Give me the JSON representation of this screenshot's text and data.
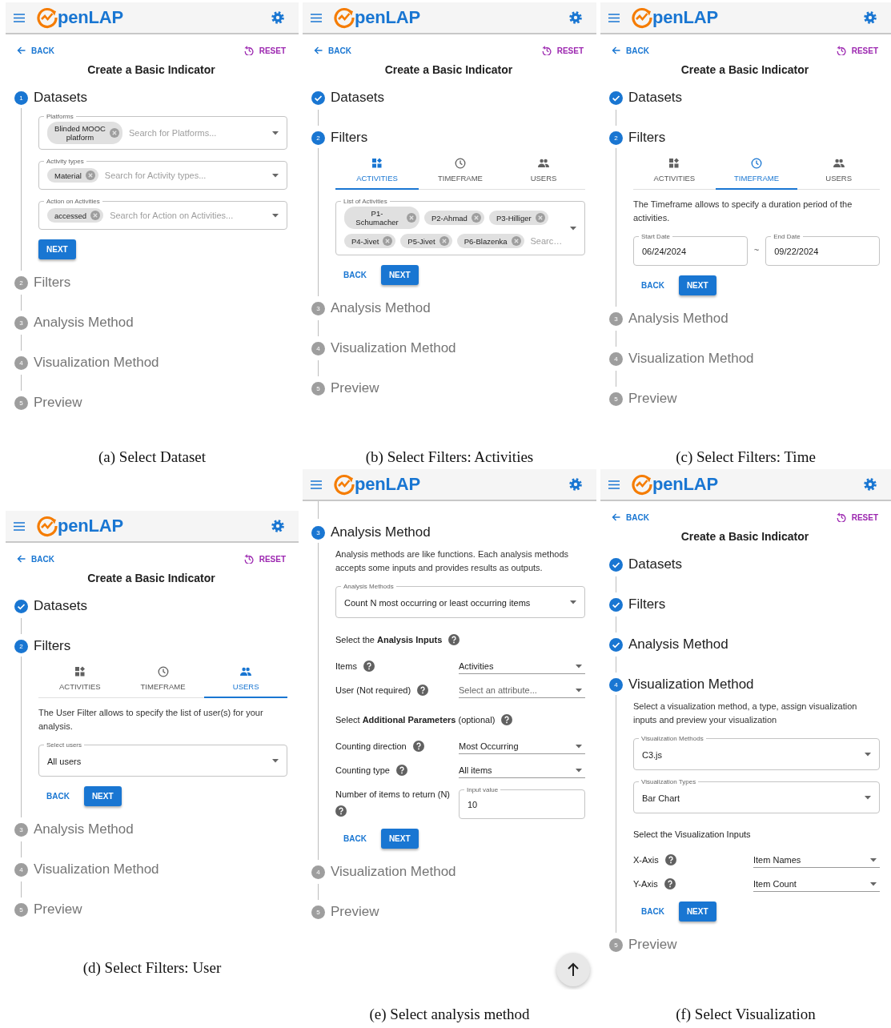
{
  "panels": [
    {
      "app_title": "penLAP",
      "nav": {
        "back": "BACK",
        "reset": "RESET",
        "title": "Create a Basic Indicator"
      },
      "caption": "(a) Select Dataset",
      "steps": [
        {
          "number": "1",
          "title": "Datasets",
          "completed": false,
          "active": true,
          "body": [
            {
              "kind": "autocomplete",
              "label": "Platforms",
              "chips": [
                "Blinded MOOC platform"
              ],
              "placeholder": "Search for Platforms..."
            },
            {
              "kind": "autocomplete",
              "label": "Activity types",
              "chips": [
                "Material"
              ],
              "placeholder": "Search for Activity types..."
            },
            {
              "kind": "autocomplete",
              "label": "Action on Activities",
              "chips": [
                "accessed"
              ],
              "placeholder": "Search for Action on Activities..."
            },
            {
              "kind": "buttons",
              "buttons": [
                {
                  "label": "NEXT",
                  "kind": "contained"
                }
              ]
            }
          ]
        },
        {
          "number": "2",
          "title": "Filters",
          "completed": false,
          "active": false
        },
        {
          "number": "3",
          "title": "Analysis Method",
          "completed": false,
          "active": false
        },
        {
          "number": "4",
          "title": "Visualization Method",
          "completed": false,
          "active": false
        },
        {
          "number": "5",
          "title": "Preview",
          "completed": false,
          "active": false
        }
      ]
    },
    {
      "app_title": "penLAP",
      "nav": {
        "back": "BACK",
        "reset": "RESET",
        "title": "Create a Basic Indicator"
      },
      "caption": "(b) Select Filters: Activities",
      "steps": [
        {
          "title": "Datasets",
          "completed": true,
          "active": false
        },
        {
          "number": "2",
          "title": "Filters",
          "completed": false,
          "active": true,
          "body": [
            {
              "kind": "tabs",
              "tabs": [
                {
                  "label": "ACTIVITIES",
                  "kind": "activities",
                  "selected": true
                },
                {
                  "label": "TIMEFRAME",
                  "kind": "timeframe",
                  "selected": false
                },
                {
                  "label": "USERS",
                  "kind": "users",
                  "selected": false
                }
              ]
            },
            {
              "kind": "autocomplete",
              "label": "List of Activities",
              "chips": [
                "P1-Schumacher",
                "P2-Ahmad",
                "P3-Hilliger",
                "P4-Jivet",
                "P5-Jivet",
                "P6-Blazenka"
              ],
              "placeholder": "Searc…"
            },
            {
              "kind": "buttons",
              "buttons": [
                {
                  "label": "BACK",
                  "kind": "text"
                },
                {
                  "label": "NEXT",
                  "kind": "contained"
                }
              ]
            }
          ]
        },
        {
          "number": "3",
          "title": "Analysis Method",
          "completed": false,
          "active": false
        },
        {
          "number": "4",
          "title": "Visualization Method",
          "completed": false,
          "active": false
        },
        {
          "number": "5",
          "title": "Preview",
          "completed": false,
          "active": false
        }
      ]
    },
    {
      "app_title": "penLAP",
      "nav": {
        "back": "BACK",
        "reset": "RESET",
        "title": "Create a Basic Indicator"
      },
      "caption": "(c) Select Filters: Time",
      "steps": [
        {
          "title": "Datasets",
          "completed": true,
          "active": false
        },
        {
          "number": "2",
          "title": "Filters",
          "completed": false,
          "active": true,
          "body": [
            {
              "kind": "tabs",
              "tabs": [
                {
                  "label": "ACTIVITIES",
                  "kind": "activities",
                  "selected": false
                },
                {
                  "label": "TIMEFRAME",
                  "kind": "timeframe",
                  "selected": true
                },
                {
                  "label": "USERS",
                  "kind": "users",
                  "selected": false
                }
              ]
            },
            {
              "kind": "text",
              "text": "The Timeframe allows to specify a duration period of the activities."
            },
            {
              "kind": "date_range",
              "separator": "~",
              "fields": [
                {
                  "label": "Start Date",
                  "value": "06/24/2024"
                },
                {
                  "label": "End Date",
                  "value": "09/22/2024"
                }
              ]
            },
            {
              "kind": "buttons",
              "buttons": [
                {
                  "label": "BACK",
                  "kind": "text"
                },
                {
                  "label": "NEXT",
                  "kind": "contained"
                }
              ]
            }
          ]
        },
        {
          "number": "3",
          "title": "Analysis Method",
          "completed": false,
          "active": false
        },
        {
          "number": "4",
          "title": "Visualization Method",
          "completed": false,
          "active": false
        },
        {
          "number": "5",
          "title": "Preview",
          "completed": false,
          "active": false
        }
      ]
    },
    {
      "app_title": "penLAP",
      "nav": {
        "back": "BACK",
        "reset": "RESET",
        "title": "Create a Basic Indicator"
      },
      "caption": "(d) Select Filters: User",
      "steps": [
        {
          "title": "Datasets",
          "completed": true,
          "active": false
        },
        {
          "number": "2",
          "title": "Filters",
          "completed": false,
          "active": true,
          "body": [
            {
              "kind": "tabs",
              "tabs": [
                {
                  "label": "ACTIVITIES",
                  "kind": "activities",
                  "selected": false
                },
                {
                  "label": "TIMEFRAME",
                  "kind": "timeframe",
                  "selected": false
                },
                {
                  "label": "USERS",
                  "kind": "users",
                  "selected": true
                }
              ]
            },
            {
              "kind": "text",
              "text": "The User Filter allows to specify the list of user(s) for your analysis."
            },
            {
              "kind": "select_outlined",
              "label": "Select users",
              "value": "All users"
            },
            {
              "kind": "buttons",
              "buttons": [
                {
                  "label": "BACK",
                  "kind": "text"
                },
                {
                  "label": "NEXT",
                  "kind": "contained"
                }
              ]
            }
          ]
        },
        {
          "number": "3",
          "title": "Analysis Method",
          "completed": false,
          "active": false
        },
        {
          "number": "4",
          "title": "Visualization Method",
          "completed": false,
          "active": false
        },
        {
          "number": "5",
          "title": "Preview",
          "completed": false,
          "active": false
        }
      ]
    },
    {
      "app_title": "penLAP",
      "continued": true,
      "scroll_top_button": true,
      "caption": "(e) Select analysis method",
      "steps": [
        {
          "number": "3",
          "title": "Analysis Method",
          "completed": false,
          "active": true,
          "body": [
            {
              "kind": "text",
              "text": "Analysis methods are like functions. Each analysis methods accepts some inputs and provides results as outputs."
            },
            {
              "kind": "select_outlined",
              "label": "Analysis Methods",
              "value": "Count N most occurring or least occurring items"
            },
            {
              "kind": "heading",
              "text": "Select the **Analysis Inputs**",
              "help": true
            },
            {
              "kind": "param",
              "label": "Items",
              "help": true,
              "control": {
                "kind": "select_underline",
                "value": "Activities"
              }
            },
            {
              "kind": "param",
              "label": "User (Not required)",
              "help": true,
              "control": {
                "kind": "select_underline",
                "placeholder": "Select an attribute..."
              }
            },
            {
              "kind": "heading",
              "text": "Select **Additional Parameters** (optional)",
              "help": true
            },
            {
              "kind": "param",
              "label": "Counting direction",
              "help": true,
              "control": {
                "kind": "select_underline",
                "value": "Most Occurring"
              }
            },
            {
              "kind": "param",
              "label": "Counting type",
              "help": true,
              "control": {
                "kind": "select_underline",
                "value": "All items"
              }
            },
            {
              "kind": "param",
              "label": "Number of items to return (N)",
              "help": true,
              "control": {
                "kind": "input_outlined",
                "label": "Input value",
                "value": "10"
              }
            },
            {
              "kind": "buttons",
              "buttons": [
                {
                  "label": "BACK",
                  "kind": "text"
                },
                {
                  "label": "NEXT",
                  "kind": "contained"
                }
              ]
            }
          ]
        },
        {
          "number": "4",
          "title": "Visualization Method",
          "completed": false,
          "active": false
        },
        {
          "number": "5",
          "title": "Preview",
          "completed": false,
          "active": false
        }
      ]
    },
    {
      "app_title": "penLAP",
      "nav": {
        "back": "BACK",
        "reset": "RESET",
        "title": "Create a Basic Indicator"
      },
      "caption": "(f) Select Visualization",
      "steps": [
        {
          "title": "Datasets",
          "completed": true,
          "active": false
        },
        {
          "title": "Filters",
          "completed": true,
          "active": false
        },
        {
          "title": "Analysis Method",
          "completed": true,
          "active": false
        },
        {
          "number": "4",
          "title": "Visualization Method",
          "completed": false,
          "active": true,
          "body": [
            {
              "kind": "text",
              "text": "Select a visualization method, a type, assign visualization inputs and preview your visualization"
            },
            {
              "kind": "select_outlined",
              "label": "Visualization Methods",
              "value": "C3.js"
            },
            {
              "kind": "select_outlined",
              "label": "Visualization Types",
              "value": "Bar Chart"
            },
            {
              "kind": "heading",
              "text": "Select the Visualization Inputs"
            },
            {
              "kind": "param",
              "label": "X-Axis",
              "help": true,
              "control": {
                "kind": "select_underline",
                "value": "Item Names"
              }
            },
            {
              "kind": "param",
              "label": "Y-Axis",
              "help": true,
              "control": {
                "kind": "select_underline",
                "value": "Item Count"
              }
            },
            {
              "kind": "buttons",
              "buttons": [
                {
                  "label": "BACK",
                  "kind": "text"
                },
                {
                  "label": "NEXT",
                  "kind": "contained"
                }
              ]
            }
          ]
        },
        {
          "number": "5",
          "title": "Preview",
          "completed": false,
          "active": false
        }
      ]
    }
  ]
}
